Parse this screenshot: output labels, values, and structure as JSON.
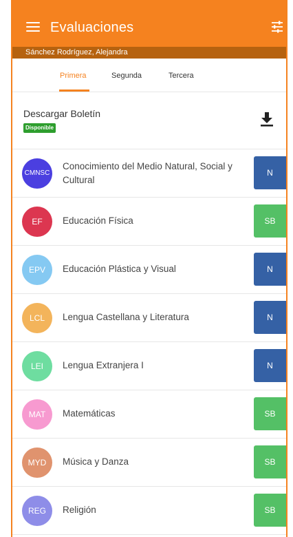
{
  "header": {
    "title": "Evaluaciones",
    "menu_icon": "hamburger-menu-icon",
    "filter_icon": "tune-filter-icon",
    "color": "#f5821f"
  },
  "student": {
    "name": "Sánchez Rodríguez, Alejandra"
  },
  "tabs": [
    {
      "label": "Primera",
      "active": true
    },
    {
      "label": "Segunda",
      "active": false
    },
    {
      "label": "Tercera",
      "active": false
    }
  ],
  "download": {
    "title": "Descargar Boletín",
    "status": "Disponible",
    "icon": "download-icon"
  },
  "subjects": [
    {
      "abbr": "CMNSC",
      "name": "Conocimiento del Medio Natural, Social y Cultural",
      "grade": "N",
      "color": "#4b3fe0"
    },
    {
      "abbr": "EF",
      "name": "Educación Física",
      "grade": "SB",
      "color": "#dc3650"
    },
    {
      "abbr": "EPV",
      "name": "Educación Plástica y Visual",
      "grade": "N",
      "color": "#85c9f2"
    },
    {
      "abbr": "LCL",
      "name": "Lengua Castellana y Literatura",
      "grade": "N",
      "color": "#f3b45b"
    },
    {
      "abbr": "LEI",
      "name": "Lengua Extranjera I",
      "grade": "N",
      "color": "#6edda0"
    },
    {
      "abbr": "MAT",
      "name": "Matemáticas",
      "grade": "SB",
      "color": "#f79ad0"
    },
    {
      "abbr": "MYD",
      "name": "Música y Danza",
      "grade": "SB",
      "color": "#e0936e"
    },
    {
      "abbr": "REG",
      "name": "Religión",
      "grade": "SB",
      "color": "#8e8de8"
    }
  ],
  "grade_colors": {
    "N": "#3561a5",
    "SB": "#54c066"
  }
}
